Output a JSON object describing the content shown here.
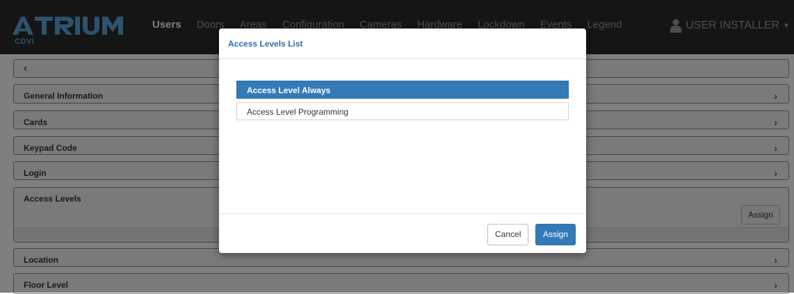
{
  "app": {
    "logo_text": "ATRIUM",
    "sub_brand": "CDVI",
    "colors": {
      "navbar_bg": "#2b2b2b",
      "accent": "#337ab7",
      "logo": "#5aa7d6"
    }
  },
  "nav": {
    "items": [
      {
        "label": "Users",
        "active": true
      },
      {
        "label": "Doors"
      },
      {
        "label": "Areas"
      },
      {
        "label": "Configuration"
      },
      {
        "label": "Cameras"
      },
      {
        "label": "Hardware"
      },
      {
        "label": "Lockdown"
      },
      {
        "label": "Events"
      },
      {
        "label": "Legend"
      }
    ],
    "user_label": "USER INSTALLER",
    "user_icon": "user-icon",
    "caret_icon": "caret-down-icon"
  },
  "panels": {
    "back_icon": "chevron-left-icon",
    "chevron_icon": "chevron-right-icon",
    "general_information": "General Information",
    "cards": "Cards",
    "keypad_code": "Keypad Code",
    "login": "Login",
    "access_levels": "Access Levels",
    "access_levels_assign": "Assign",
    "location": "Location",
    "floor_level": "Floor Level"
  },
  "modal": {
    "title": "Access Levels List",
    "list_items": [
      {
        "label": "Access Level Always",
        "selected": true
      },
      {
        "label": "Access Level Programming",
        "selected": false
      }
    ],
    "cancel_label": "Cancel",
    "assign_label": "Assign"
  }
}
